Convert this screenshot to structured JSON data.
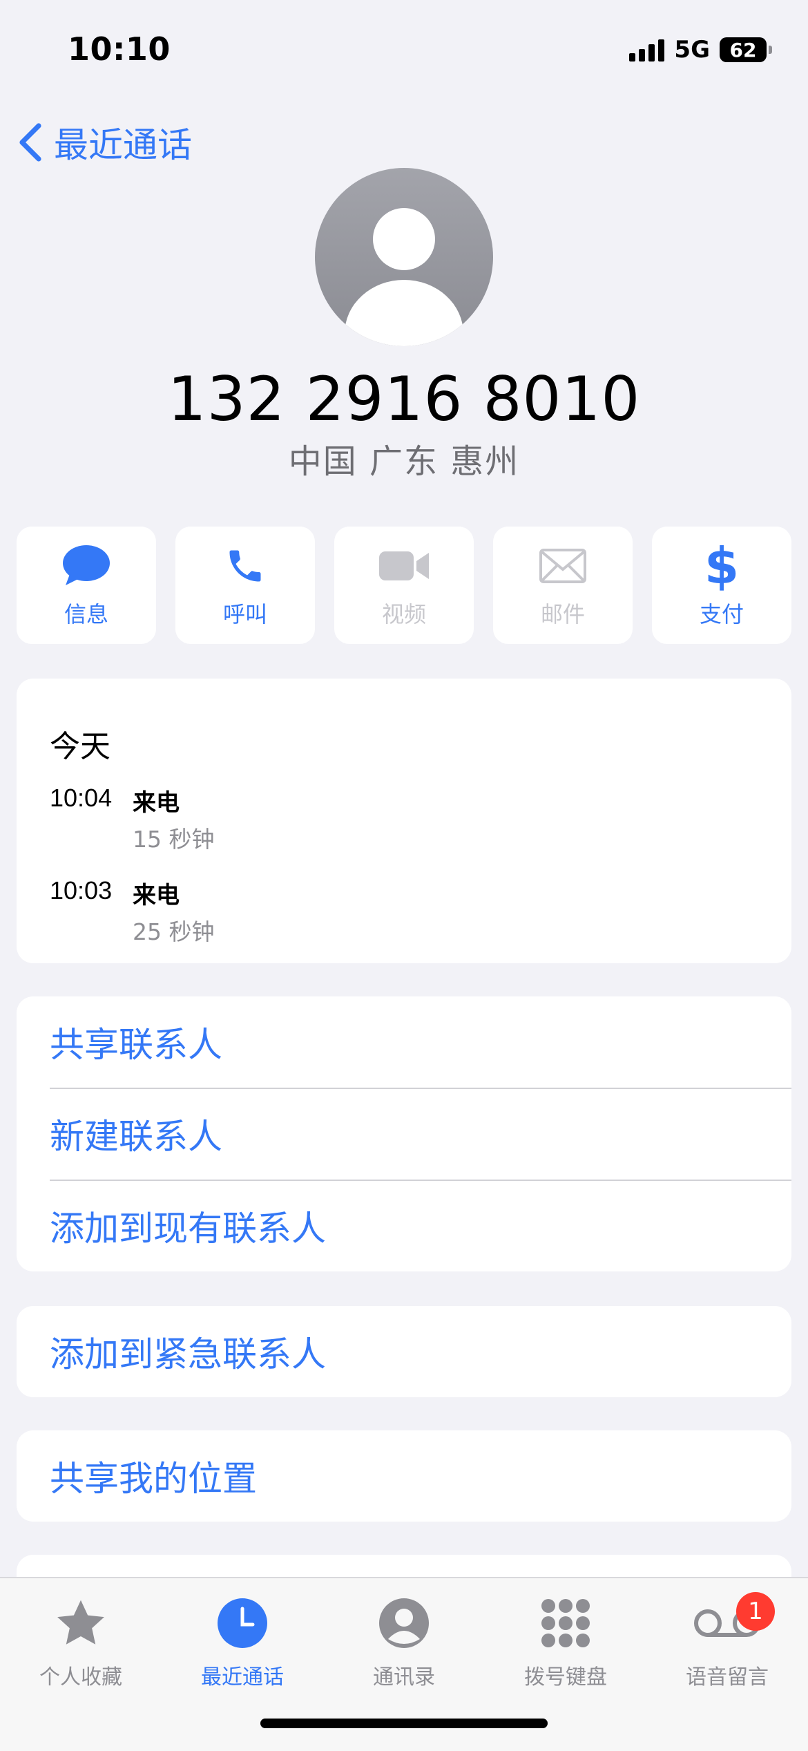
{
  "status_bar": {
    "time": "10:10",
    "network": "5G",
    "battery": "62"
  },
  "nav": {
    "back_label": "最近通话"
  },
  "contact": {
    "number": "132 2916 8010",
    "location": "中国 广东 惠州"
  },
  "actions": [
    {
      "label": "信息",
      "icon": "message-icon",
      "enabled": true
    },
    {
      "label": "呼叫",
      "icon": "phone-icon",
      "enabled": true
    },
    {
      "label": "视频",
      "icon": "video-icon",
      "enabled": false
    },
    {
      "label": "邮件",
      "icon": "mail-icon",
      "enabled": false
    },
    {
      "label": "支付",
      "icon": "dollar-icon",
      "enabled": true
    }
  ],
  "history": {
    "title": "今天",
    "entries": [
      {
        "time": "10:04",
        "type": "来电",
        "duration": "15 秒钟"
      },
      {
        "time": "10:03",
        "type": "来电",
        "duration": "25 秒钟"
      }
    ]
  },
  "menu": {
    "share_contact": "共享联系人",
    "new_contact": "新建联系人",
    "add_existing": "添加到现有联系人",
    "add_emergency": "添加到紧急联系人",
    "share_location": "共享我的位置"
  },
  "tabs": [
    {
      "label": "个人收藏",
      "icon": "star-icon",
      "active": false
    },
    {
      "label": "最近通话",
      "icon": "clock-icon",
      "active": true
    },
    {
      "label": "通讯录",
      "icon": "contacts-icon",
      "active": false
    },
    {
      "label": "拨号键盘",
      "icon": "keypad-icon",
      "active": false
    },
    {
      "label": "语音留言",
      "icon": "voicemail-icon",
      "active": false,
      "badge": "1"
    }
  ],
  "colors": {
    "accent": "#3478f6",
    "background": "#f2f2f7",
    "disabled": "#c7c7cc",
    "badge": "#ff3b30"
  }
}
